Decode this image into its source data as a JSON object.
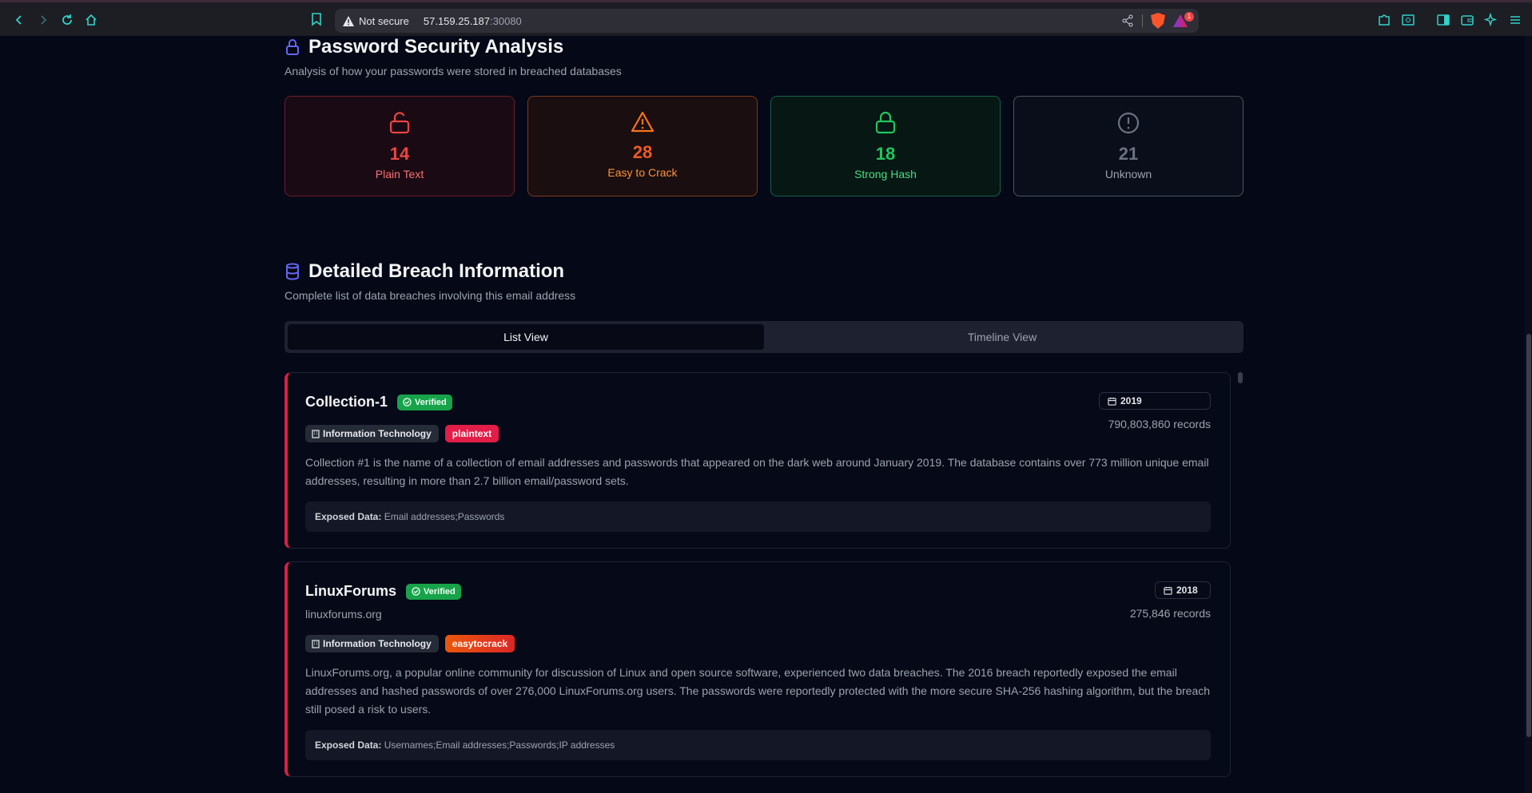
{
  "browser": {
    "not_secure": "Not secure",
    "host": "57.159.25.187",
    "port": ":30080",
    "notification_count": "1"
  },
  "password_security": {
    "title": "Password Security Analysis",
    "subtitle": "Analysis of how your passwords were stored in breached databases",
    "stats": [
      {
        "value": "14",
        "label": "Plain Text",
        "icon": "unlock-icon"
      },
      {
        "value": "28",
        "label": "Easy to Crack",
        "icon": "warning-icon"
      },
      {
        "value": "18",
        "label": "Strong Hash",
        "icon": "lock-icon"
      },
      {
        "value": "21",
        "label": "Unknown",
        "icon": "alert-circle-icon"
      }
    ]
  },
  "breach_info": {
    "title": "Detailed Breach Information",
    "subtitle": "Complete list of data breaches involving this email address",
    "tabs": [
      {
        "label": "List View",
        "active": true
      },
      {
        "label": "Timeline View",
        "active": false
      }
    ],
    "breaches": [
      {
        "name": "Collection-1",
        "verified": "Verified",
        "year": "2019",
        "records": "790,803,860 records",
        "domain": "",
        "industry": "Information Technology",
        "password_tag": "plaintext",
        "description": "Collection #1 is the name of a collection of email addresses and passwords that appeared on the dark web around January 2019. The database contains over 773 million unique email addresses, resulting in more than 2.7 billion email/password sets.",
        "exposed_label": "Exposed Data:",
        "exposed": "Email addresses;Passwords"
      },
      {
        "name": "LinuxForums",
        "verified": "Verified",
        "year": "2018",
        "records": "275,846 records",
        "domain": "linuxforums.org",
        "industry": "Information Technology",
        "password_tag": "easytocrack",
        "description": "LinuxForums.org, a popular online community for discussion of Linux and open source software, experienced two data breaches. The 2016 breach reportedly exposed the email addresses and hashed passwords of over 276,000 LinuxForums.org users. The passwords were reportedly protected with the more secure SHA-256 hashing algorithm, but the breach still posed a risk to users.",
        "exposed_label": "Exposed Data:",
        "exposed": "Usernames;Email addresses;Passwords;IP addresses"
      }
    ]
  },
  "colors": {
    "accent": "#6366f1",
    "plaintext": "#e11d48",
    "easy": "#f97316",
    "strong": "#22c55e",
    "unknown": "#6b7280",
    "verified": "#16a34a"
  }
}
